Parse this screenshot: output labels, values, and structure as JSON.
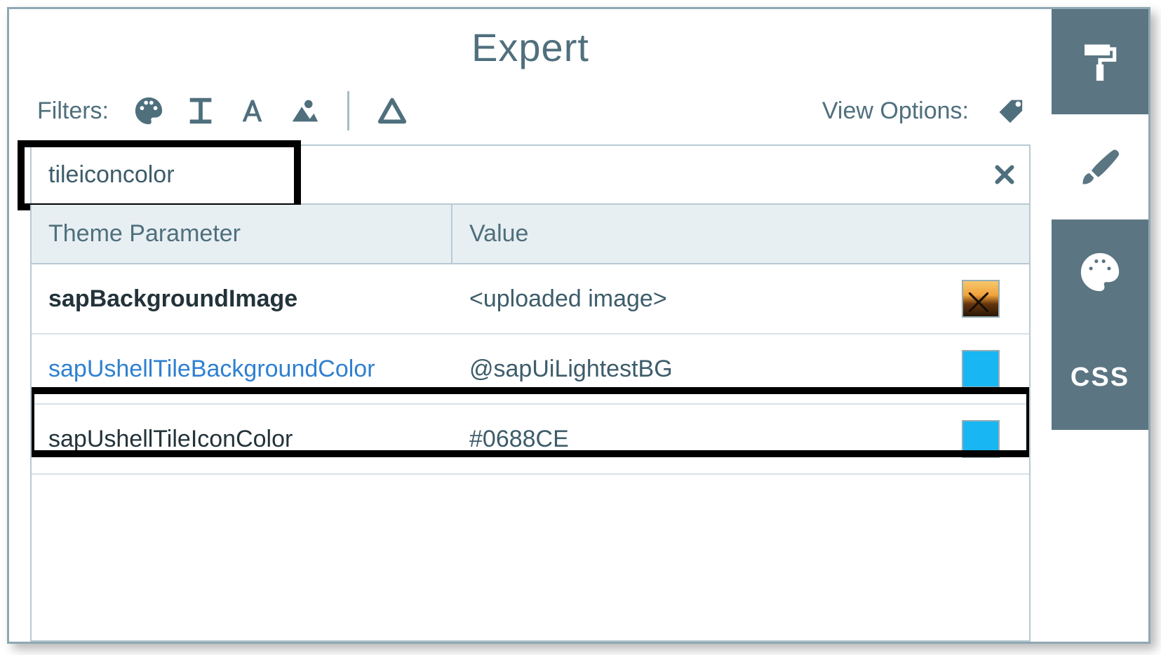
{
  "title": "Expert",
  "filters_label": "Filters:",
  "view_options_label": "View Options:",
  "search": {
    "value": "tileiconcolor"
  },
  "columns": {
    "param": "Theme Parameter",
    "value": "Value"
  },
  "rows": [
    {
      "param": "sapBackgroundImage",
      "value": "<uploaded image>",
      "swatch_type": "image",
      "swatch_color": "",
      "bold": true
    },
    {
      "param": "sapUshellTileBackgroundColor",
      "value": "@sapUiLightestBG",
      "swatch_type": "color",
      "swatch_color": "#18B6F2",
      "link": true
    },
    {
      "param": "sapUshellTileIconColor",
      "value": "#0688CE",
      "swatch_type": "color",
      "swatch_color": "#18B6F2",
      "highlight": true
    }
  ],
  "sidebar": {
    "css_label": "CSS"
  }
}
